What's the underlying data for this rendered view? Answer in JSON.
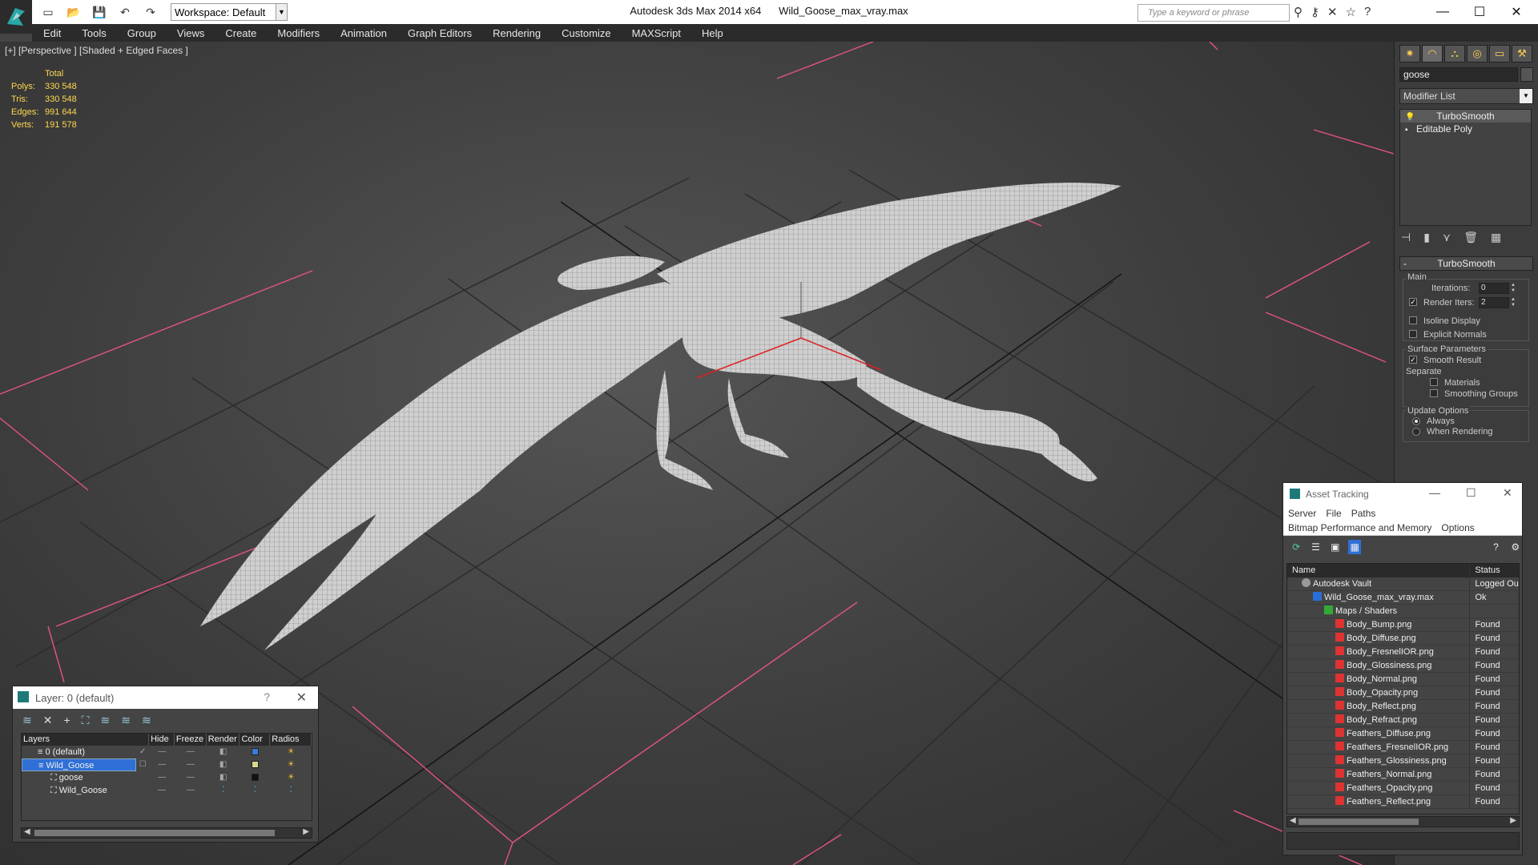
{
  "title": {
    "app": "Autodesk 3ds Max  2014 x64",
    "file": "Wild_Goose_max_vray.max",
    "workspace": "Workspace: Default",
    "search_placeholder": "Type a keyword or phrase"
  },
  "menu": [
    "Edit",
    "Tools",
    "Group",
    "Views",
    "Create",
    "Modifiers",
    "Animation",
    "Graph Editors",
    "Rendering",
    "Customize",
    "MAXScript",
    "Help"
  ],
  "viewport": {
    "label": "[+] [Perspective ] [Shaded + Edged Faces ]",
    "stats": {
      "header": "Total",
      "rows": [
        {
          "label": "Polys:",
          "value": "330 548"
        },
        {
          "label": "Tris:",
          "value": "330 548"
        },
        {
          "label": "Edges:",
          "value": "991 644"
        },
        {
          "label": "Verts:",
          "value": "191 578"
        }
      ]
    }
  },
  "command_panel": {
    "object_name": "goose",
    "modifier_list": "Modifier List",
    "stack": [
      "TurboSmooth",
      "Editable Poly"
    ],
    "rollout_title": "TurboSmooth",
    "main_label": "Main",
    "iterations_label": "Iterations:",
    "iterations_value": "0",
    "render_iters_label": "Render Iters:",
    "render_iters_value": "2",
    "isoline_display": "Isoline Display",
    "explicit_normals": "Explicit Normals",
    "surface_parameters": "Surface Parameters",
    "smooth_result": "Smooth Result",
    "separate": "Separate",
    "materials": "Materials",
    "smoothing_groups": "Smoothing Groups",
    "update_options": "Update Options",
    "always": "Always",
    "when_rendering": "When Rendering"
  },
  "layer_dialog": {
    "title": "Layer: 0 (default)",
    "help": "?",
    "columns": [
      "Layers",
      "Hide",
      "Freeze",
      "Render",
      "Color",
      "Radios"
    ],
    "rows": [
      {
        "name": "0 (default)",
        "color": "#3a7bd5",
        "indent": 1
      },
      {
        "name": "Wild_Goose",
        "color": "#d8d890",
        "indent": 1
      },
      {
        "name": "goose",
        "color": "#111111",
        "indent": 2
      },
      {
        "name": "Wild_Goose",
        "color": "",
        "indent": 2
      }
    ]
  },
  "asset_dialog": {
    "title": "Asset Tracking",
    "menu1": [
      "Server",
      "File",
      "Paths"
    ],
    "menu2": [
      "Bitmap Performance and Memory",
      "Options"
    ],
    "columns": [
      "Name",
      "Status"
    ],
    "rows": [
      {
        "name": "Autodesk Vault",
        "status": "Logged Out",
        "indent": 1,
        "icon": "vault"
      },
      {
        "name": "Wild_Goose_max_vray.max",
        "status": "Ok",
        "indent": 2,
        "icon": "max"
      },
      {
        "name": "Maps / Shaders",
        "status": "",
        "indent": 3,
        "icon": "maps"
      },
      {
        "name": "Body_Bump.png",
        "status": "Found",
        "indent": 4,
        "icon": "png"
      },
      {
        "name": "Body_Diffuse.png",
        "status": "Found",
        "indent": 4,
        "icon": "png"
      },
      {
        "name": "Body_FresnelIOR.png",
        "status": "Found",
        "indent": 4,
        "icon": "png"
      },
      {
        "name": "Body_Glossiness.png",
        "status": "Found",
        "indent": 4,
        "icon": "png"
      },
      {
        "name": "Body_Normal.png",
        "status": "Found",
        "indent": 4,
        "icon": "png"
      },
      {
        "name": "Body_Opacity.png",
        "status": "Found",
        "indent": 4,
        "icon": "png"
      },
      {
        "name": "Body_Reflect.png",
        "status": "Found",
        "indent": 4,
        "icon": "png"
      },
      {
        "name": "Body_Refract.png",
        "status": "Found",
        "indent": 4,
        "icon": "png"
      },
      {
        "name": "Feathers_Diffuse.png",
        "status": "Found",
        "indent": 4,
        "icon": "png"
      },
      {
        "name": "Feathers_FresnelIOR.png",
        "status": "Found",
        "indent": 4,
        "icon": "png"
      },
      {
        "name": "Feathers_Glossiness.png",
        "status": "Found",
        "indent": 4,
        "icon": "png"
      },
      {
        "name": "Feathers_Normal.png",
        "status": "Found",
        "indent": 4,
        "icon": "png"
      },
      {
        "name": "Feathers_Opacity.png",
        "status": "Found",
        "indent": 4,
        "icon": "png"
      },
      {
        "name": "Feathers_Reflect.png",
        "status": "Found",
        "indent": 4,
        "icon": "png"
      }
    ]
  },
  "colors": {
    "menubar": "#2b2b2b",
    "viewport_stats": "#ffd84d",
    "selection": "#2f6fd6",
    "grid_accent": "#ff5f9e"
  }
}
